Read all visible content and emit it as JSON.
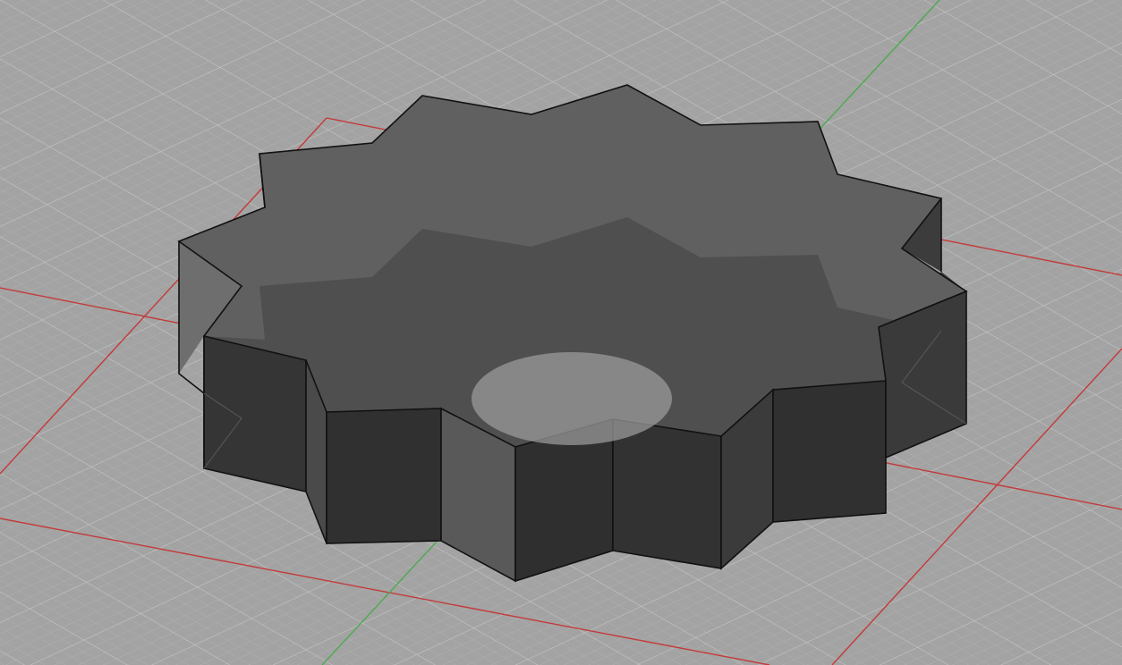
{
  "viewport": {
    "background_color": "#a3a3a3",
    "grid_minor_color": "#b3b3b3",
    "grid_major_color": "#c4c4c4",
    "x_axis_color": "#c43a3a",
    "y_axis_color": "#4caa4c"
  },
  "model": {
    "shape": "star-gear-prism",
    "tooth_count": 12,
    "top_face_color": "#5f5f5f",
    "side_face_dark_color": "#2f2f2f",
    "side_face_light_color": "#585858",
    "inner_shadow_color": "#4c4c4c",
    "highlight_color": "#9a9a9a",
    "edge_color": "#111111",
    "transparent": true
  }
}
